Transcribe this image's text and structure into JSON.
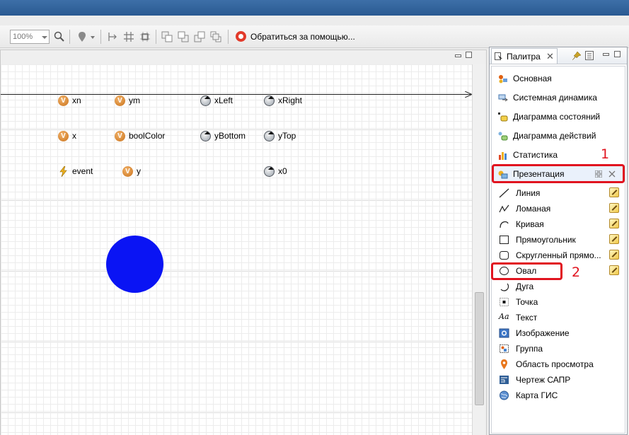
{
  "toolbar": {
    "zoom_value": "100%",
    "help_label": "Обратиться за помощью..."
  },
  "canvas": {
    "variables_row1": [
      {
        "name": "xn",
        "icon": "variable-icon"
      },
      {
        "name": "ym",
        "icon": "variable-icon"
      },
      {
        "name": "xLeft",
        "icon": "parameter-icon"
      },
      {
        "name": "xRight",
        "icon": "parameter-icon"
      }
    ],
    "variables_row2": [
      {
        "name": "x",
        "icon": "variable-icon"
      },
      {
        "name": "boolColor",
        "icon": "variable-icon"
      },
      {
        "name": "yBottom",
        "icon": "parameter-icon"
      },
      {
        "name": "yTop",
        "icon": "parameter-icon"
      }
    ],
    "variables_row3": [
      {
        "name": "event",
        "icon": "event-icon"
      },
      {
        "name": "y",
        "icon": "variable-icon"
      },
      {
        "name": "x0",
        "icon": "parameter-icon"
      }
    ],
    "variable_icon_letter": "V",
    "oval_color": "#0a14f4"
  },
  "palette": {
    "tab_title": "Палитра",
    "tab_close": "✕",
    "categories": [
      {
        "label": "Основная",
        "icon": "main-palette-icon"
      },
      {
        "label": "Системная динамика",
        "icon": "system-dynamics-icon"
      },
      {
        "label": "Диаграмма состояний",
        "icon": "statechart-icon"
      },
      {
        "label": "Диаграмма действий",
        "icon": "action-chart-icon"
      },
      {
        "label": "Статистика",
        "icon": "statistics-icon"
      },
      {
        "label": "Презентация",
        "icon": "presentation-icon"
      }
    ],
    "presentation_items": [
      {
        "label": "Линия",
        "icon": "line-icon",
        "editable": true
      },
      {
        "label": "Ломаная",
        "icon": "polyline-icon",
        "editable": true
      },
      {
        "label": "Кривая",
        "icon": "curve-icon",
        "editable": true
      },
      {
        "label": "Прямоугольник",
        "icon": "rectangle-icon",
        "editable": true
      },
      {
        "label": "Скругленный прямо...",
        "icon": "rounded-rectangle-icon",
        "editable": true
      },
      {
        "label": "Овал",
        "icon": "oval-icon",
        "editable": true
      },
      {
        "label": "Дуга",
        "icon": "arc-icon",
        "editable": false
      },
      {
        "label": "Точка",
        "icon": "point-icon",
        "editable": false
      },
      {
        "label": "Текст",
        "icon": "text-icon",
        "editable": false
      },
      {
        "label": "Изображение",
        "icon": "image-icon",
        "editable": false
      },
      {
        "label": "Группа",
        "icon": "group-icon",
        "editable": false
      },
      {
        "label": "Область просмотра",
        "icon": "view-area-icon",
        "editable": false
      },
      {
        "label": "Чертеж САПР",
        "icon": "cad-drawing-icon",
        "editable": false
      },
      {
        "label": "Карта ГИС",
        "icon": "gis-map-icon",
        "editable": false
      }
    ],
    "text_icon_glyph": "Aa"
  },
  "annotations": {
    "marker_1": "1",
    "marker_2": "2",
    "color": "#e1141f"
  }
}
